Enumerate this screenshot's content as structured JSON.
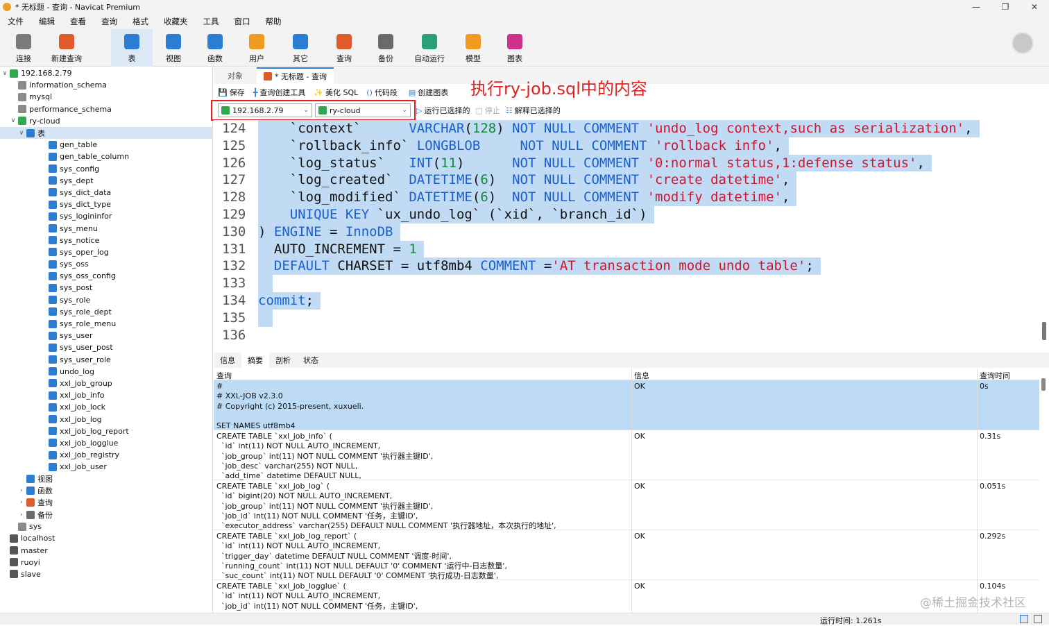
{
  "window": {
    "title": "* 无标题 - 查询 - Navicat Premium"
  },
  "menu": [
    "文件",
    "编辑",
    "查看",
    "查询",
    "格式",
    "收藏夹",
    "工具",
    "窗口",
    "帮助"
  ],
  "toolbar": [
    {
      "label": "连接",
      "icon": "plug-icon",
      "color": "#7a7a7a"
    },
    {
      "label": "新建查询",
      "icon": "new-query-icon",
      "color": "#e05a2a"
    },
    {
      "label": "表",
      "icon": "table-icon",
      "color": "#2b7cd3",
      "active": true
    },
    {
      "label": "视图",
      "icon": "view-icon",
      "color": "#2b7cd3"
    },
    {
      "label": "函数",
      "icon": "function-icon",
      "color": "#2b7cd3"
    },
    {
      "label": "用户",
      "icon": "user-icon",
      "color": "#f29a1f"
    },
    {
      "label": "其它",
      "icon": "tools-icon",
      "color": "#2b7cd3"
    },
    {
      "label": "查询",
      "icon": "query-icon",
      "color": "#e05a2a"
    },
    {
      "label": "备份",
      "icon": "backup-icon",
      "color": "#6b6b6b"
    },
    {
      "label": "自动运行",
      "icon": "robot-icon",
      "color": "#29a07a"
    },
    {
      "label": "模型",
      "icon": "model-icon",
      "color": "#f29a1f"
    },
    {
      "label": "图表",
      "icon": "chart-icon",
      "color": "#d0308c"
    }
  ],
  "tree": [
    {
      "label": "192.168.2.79",
      "level": 0,
      "arrow": "v",
      "type": "conn"
    },
    {
      "label": "information_schema",
      "level": 1,
      "type": "db"
    },
    {
      "label": "mysql",
      "level": 1,
      "type": "db"
    },
    {
      "label": "performance_schema",
      "level": 1,
      "type": "db"
    },
    {
      "label": "ry-cloud",
      "level": 1,
      "arrow": "v",
      "type": "dbopen"
    },
    {
      "label": "表",
      "level": 2,
      "arrow": "v",
      "type": "tables",
      "selected": true
    },
    {
      "label": "gen_table",
      "level": 3,
      "type": "table"
    },
    {
      "label": "gen_table_column",
      "level": 3,
      "type": "table"
    },
    {
      "label": "sys_config",
      "level": 3,
      "type": "table"
    },
    {
      "label": "sys_dept",
      "level": 3,
      "type": "table"
    },
    {
      "label": "sys_dict_data",
      "level": 3,
      "type": "table"
    },
    {
      "label": "sys_dict_type",
      "level": 3,
      "type": "table"
    },
    {
      "label": "sys_logininfor",
      "level": 3,
      "type": "table"
    },
    {
      "label": "sys_menu",
      "level": 3,
      "type": "table"
    },
    {
      "label": "sys_notice",
      "level": 3,
      "type": "table"
    },
    {
      "label": "sys_oper_log",
      "level": 3,
      "type": "table"
    },
    {
      "label": "sys_oss",
      "level": 3,
      "type": "table"
    },
    {
      "label": "sys_oss_config",
      "level": 3,
      "type": "table"
    },
    {
      "label": "sys_post",
      "level": 3,
      "type": "table"
    },
    {
      "label": "sys_role",
      "level": 3,
      "type": "table"
    },
    {
      "label": "sys_role_dept",
      "level": 3,
      "type": "table"
    },
    {
      "label": "sys_role_menu",
      "level": 3,
      "type": "table"
    },
    {
      "label": "sys_user",
      "level": 3,
      "type": "table"
    },
    {
      "label": "sys_user_post",
      "level": 3,
      "type": "table"
    },
    {
      "label": "sys_user_role",
      "level": 3,
      "type": "table"
    },
    {
      "label": "undo_log",
      "level": 3,
      "type": "table"
    },
    {
      "label": "xxl_job_group",
      "level": 3,
      "type": "table"
    },
    {
      "label": "xxl_job_info",
      "level": 3,
      "type": "table"
    },
    {
      "label": "xxl_job_lock",
      "level": 3,
      "type": "table"
    },
    {
      "label": "xxl_job_log",
      "level": 3,
      "type": "table"
    },
    {
      "label": "xxl_job_log_report",
      "level": 3,
      "type": "table"
    },
    {
      "label": "xxl_job_logglue",
      "level": 3,
      "type": "table"
    },
    {
      "label": "xxl_job_registry",
      "level": 3,
      "type": "table"
    },
    {
      "label": "xxl_job_user",
      "level": 3,
      "type": "table"
    },
    {
      "label": "视图",
      "level": 2,
      "type": "view"
    },
    {
      "label": "函数",
      "level": 2,
      "arrow": ">",
      "type": "func"
    },
    {
      "label": "查询",
      "level": 2,
      "arrow": ">",
      "type": "query"
    },
    {
      "label": "备份",
      "level": 2,
      "arrow": ">",
      "type": "backup"
    },
    {
      "label": "sys",
      "level": 1,
      "type": "db"
    },
    {
      "label": "localhost",
      "level": 0,
      "type": "connoff"
    },
    {
      "label": "master",
      "level": 0,
      "type": "connoff"
    },
    {
      "label": "ruoyi",
      "level": 0,
      "type": "connoff"
    },
    {
      "label": "slave",
      "level": 0,
      "type": "connoff"
    }
  ],
  "tabs": {
    "objects": "对象",
    "query": "* 无标题 - 查询"
  },
  "query_toolbar": {
    "save": "保存",
    "builder": "查询创建工具",
    "beautify": "美化 SQL",
    "snippet": "代码段",
    "create_chart": "创建图表"
  },
  "connection": {
    "server": "192.168.2.79",
    "database": "ry-cloud",
    "run_selected": "运行已选择的",
    "stop": "停止",
    "explain_selected": "解释已选择的"
  },
  "annotation": "执行ry-job.sql中的内容",
  "editor_lines": [
    {
      "n": "124",
      "parts": [
        [
          "pl",
          "    `context`      "
        ],
        [
          "kw",
          "VARCHAR"
        ],
        [
          "pl",
          "("
        ],
        [
          "num",
          "128"
        ],
        [
          "pl",
          ") "
        ],
        [
          "kw",
          "NOT NULL COMMENT "
        ],
        [
          "str",
          "'undo_log context,such as serialization'"
        ],
        [
          "pl",
          ","
        ]
      ]
    },
    {
      "n": "125",
      "parts": [
        [
          "pl",
          "    `rollback_info` "
        ],
        [
          "kw",
          "LONGBLOB     NOT NULL COMMENT "
        ],
        [
          "str",
          "'rollback info'"
        ],
        [
          "pl",
          ","
        ]
      ]
    },
    {
      "n": "126",
      "parts": [
        [
          "pl",
          "    `log_status`   "
        ],
        [
          "kw",
          "INT"
        ],
        [
          "pl",
          "("
        ],
        [
          "num",
          "11"
        ],
        [
          "pl",
          ")      "
        ],
        [
          "kw",
          "NOT NULL COMMENT "
        ],
        [
          "str",
          "'0:normal status,1:defense status'"
        ],
        [
          "pl",
          ","
        ]
      ]
    },
    {
      "n": "127",
      "parts": [
        [
          "pl",
          "    `log_created`  "
        ],
        [
          "kw",
          "DATETIME"
        ],
        [
          "pl",
          "("
        ],
        [
          "num",
          "6"
        ],
        [
          "pl",
          ")  "
        ],
        [
          "kw",
          "NOT NULL COMMENT "
        ],
        [
          "str",
          "'create datetime'"
        ],
        [
          "pl",
          ","
        ]
      ]
    },
    {
      "n": "128",
      "parts": [
        [
          "pl",
          "    `log_modified` "
        ],
        [
          "kw",
          "DATETIME"
        ],
        [
          "pl",
          "("
        ],
        [
          "num",
          "6"
        ],
        [
          "pl",
          ")  "
        ],
        [
          "kw",
          "NOT NULL COMMENT "
        ],
        [
          "str",
          "'modify datetime'"
        ],
        [
          "pl",
          ","
        ]
      ]
    },
    {
      "n": "129",
      "parts": [
        [
          "kw",
          "    UNIQUE KEY "
        ],
        [
          "pl",
          "`ux_undo_log` (`xid`, `branch_id`)"
        ]
      ]
    },
    {
      "n": "130",
      "parts": [
        [
          "pl",
          ") "
        ],
        [
          "kw",
          "ENGINE "
        ],
        [
          "pl",
          "= "
        ],
        [
          "kw",
          "InnoDB"
        ]
      ]
    },
    {
      "n": "131",
      "parts": [
        [
          "pl",
          "  AUTO_INCREMENT = "
        ],
        [
          "num",
          "1"
        ]
      ]
    },
    {
      "n": "132",
      "parts": [
        [
          "kw",
          "  DEFAULT "
        ],
        [
          "pl",
          "CHARSET = utf8mb4 "
        ],
        [
          "kw",
          "COMMENT "
        ],
        [
          "pl",
          "="
        ],
        [
          "str",
          "'AT transaction mode undo table'"
        ],
        [
          "pl",
          ";"
        ]
      ]
    },
    {
      "n": "133",
      "parts": [
        [
          "pl",
          " "
        ]
      ]
    },
    {
      "n": "134",
      "parts": [
        [
          "kw",
          "commit"
        ],
        [
          "pl",
          ";"
        ]
      ]
    },
    {
      "n": "135",
      "parts": [
        [
          "pl",
          " "
        ]
      ]
    },
    {
      "n": "136",
      "parts": []
    }
  ],
  "result_tabs": [
    "信息",
    "摘要",
    "剖析",
    "状态"
  ],
  "result_headers": {
    "query": "查询",
    "info": "信息",
    "time": "查询时间"
  },
  "result_rows": [
    {
      "query": "#\n# XXL-JOB v2.3.0\n# Copyright (c) 2015-present, xuxueli.\n\nSET NAMES utf8mb4",
      "info": "OK",
      "time": "0s",
      "selected": true
    },
    {
      "query": "CREATE TABLE `xxl_job_info` (\n  `id` int(11) NOT NULL AUTO_INCREMENT,\n  `job_group` int(11) NOT NULL COMMENT '执行器主键ID',\n  `job_desc` varchar(255) NOT NULL,\n  `add_time` datetime DEFAULT NULL,",
      "info": "OK",
      "time": "0.31s"
    },
    {
      "query": "CREATE TABLE `xxl_job_log` (\n  `id` bigint(20) NOT NULL AUTO_INCREMENT,\n  `job_group` int(11) NOT NULL COMMENT '执行器主键ID',\n  `job_id` int(11) NOT NULL COMMENT '任务，主键ID',\n  `executor_address` varchar(255) DEFAULT NULL COMMENT '执行器地址，本次执行的地址',",
      "info": "OK",
      "time": "0.051s"
    },
    {
      "query": "CREATE TABLE `xxl_job_log_report` (\n  `id` int(11) NOT NULL AUTO_INCREMENT,\n  `trigger_day` datetime DEFAULT NULL COMMENT '调度-时间',\n  `running_count` int(11) NOT NULL DEFAULT '0' COMMENT '运行中-日志数量',\n  `suc_count` int(11) NOT NULL DEFAULT '0' COMMENT '执行成功-日志数量',",
      "info": "OK",
      "time": "0.292s"
    },
    {
      "query": "CREATE TABLE `xxl_job_logglue` (\n  `id` int(11) NOT NULL AUTO_INCREMENT,\n  `job_id` int(11) NOT NULL COMMENT '任务，主键ID',",
      "info": "OK",
      "time": "0.104s"
    }
  ],
  "status": {
    "runtime": "运行时间: 1.261s"
  },
  "watermark": "@稀土掘金技术社区"
}
